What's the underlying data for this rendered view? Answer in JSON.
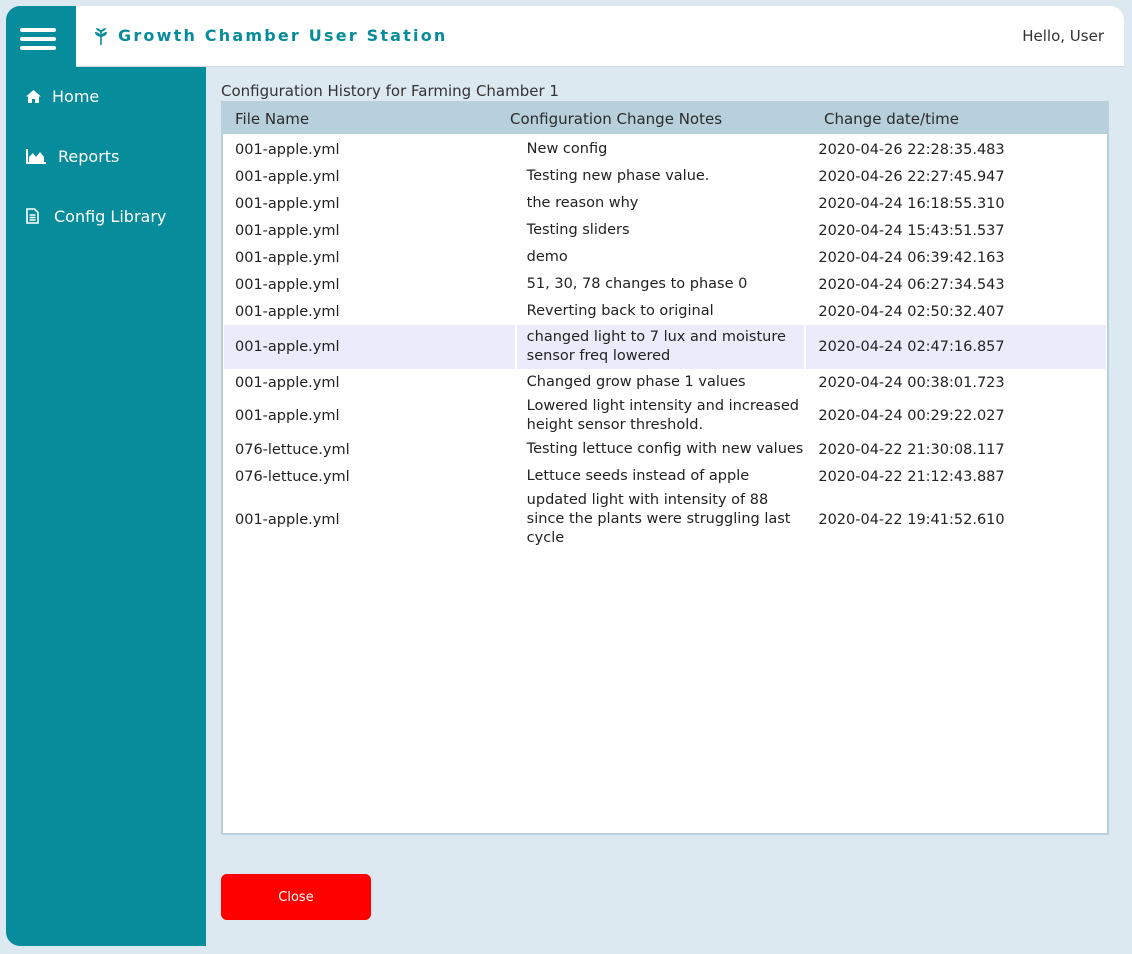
{
  "header": {
    "app_title": "Growth Chamber User Station",
    "greeting": "Hello, User"
  },
  "sidebar": {
    "items": [
      {
        "label": "Home",
        "icon": "home-icon"
      },
      {
        "label": "Reports",
        "icon": "area-chart-icon"
      },
      {
        "label": "Config Library",
        "icon": "document-icon"
      }
    ]
  },
  "main": {
    "title": "Configuration History for Farming Chamber 1",
    "columns": [
      "File Name",
      "Configuration Change Notes",
      "Change date/time"
    ],
    "rows": [
      {
        "file": "001-apple.yml",
        "notes": "New config",
        "datetime": "2020-04-26 22:28:35.483"
      },
      {
        "file": "001-apple.yml",
        "notes": "Testing new phase value.",
        "datetime": "2020-04-26 22:27:45.947"
      },
      {
        "file": "001-apple.yml",
        "notes": "the reason why",
        "datetime": "2020-04-24 16:18:55.310"
      },
      {
        "file": "001-apple.yml",
        "notes": "Testing sliders",
        "datetime": "2020-04-24 15:43:51.537"
      },
      {
        "file": "001-apple.yml",
        "notes": "demo",
        "datetime": "2020-04-24 06:39:42.163"
      },
      {
        "file": "001-apple.yml",
        "notes": "51, 30, 78 changes to phase 0",
        "datetime": "2020-04-24 06:27:34.543"
      },
      {
        "file": "001-apple.yml",
        "notes": "Reverting back to original",
        "datetime": "2020-04-24 02:50:32.407"
      },
      {
        "file": "001-apple.yml",
        "notes": "changed light to 7 lux and moisture sensor freq lowered",
        "datetime": "2020-04-24 02:47:16.857"
      },
      {
        "file": "001-apple.yml",
        "notes": "Changed grow phase 1 values",
        "datetime": "2020-04-24 00:38:01.723"
      },
      {
        "file": "001-apple.yml",
        "notes": "Lowered light intensity and increased height sensor threshold.",
        "datetime": "2020-04-24 00:29:22.027"
      },
      {
        "file": "076-lettuce.yml",
        "notes": "Testing lettuce config with new values",
        "datetime": "2020-04-22 21:30:08.117"
      },
      {
        "file": "076-lettuce.yml",
        "notes": "Lettuce seeds instead of apple",
        "datetime": "2020-04-22 21:12:43.887"
      },
      {
        "file": "001-apple.yml",
        "notes": "updated light with intensity of 88 since the plants were struggling last cycle",
        "datetime": "2020-04-22 19:41:52.610"
      }
    ],
    "selected_row": 7
  },
  "footer": {
    "close_label": "Close"
  },
  "colors": {
    "sidebar": "#078c9b",
    "brand_text": "#078c9b",
    "table_header": "#b8cfdc",
    "selected_row": "#ecebfb",
    "close_button": "#ff0000",
    "page_bg": "#dde9f1"
  }
}
